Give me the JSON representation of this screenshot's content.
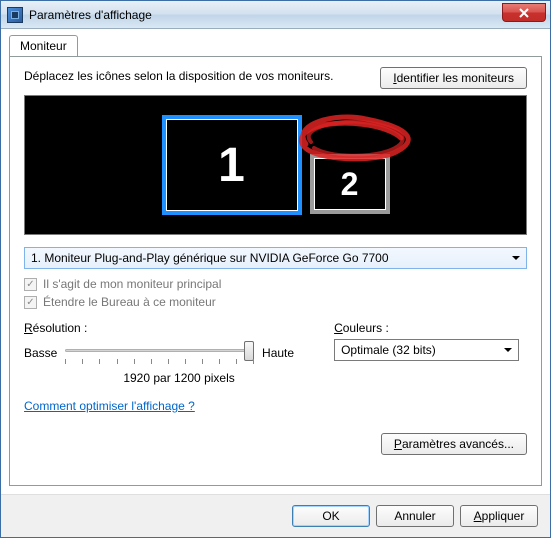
{
  "window": {
    "title": "Paramètres d'affichage"
  },
  "tab": {
    "label": "Moniteur"
  },
  "instructions": "Déplacez les icônes selon la disposition de vos moniteurs.",
  "identify_button": "Identifier les moniteurs",
  "monitors": {
    "primary_label": "1",
    "secondary_label": "2"
  },
  "monitor_dropdown": {
    "selected": "1. Moniteur Plug-and-Play générique sur NVIDIA GeForce Go 7700"
  },
  "checkboxes": {
    "primary": "Il s'agit de mon moniteur principal",
    "extend": "Étendre le Bureau à ce moniteur"
  },
  "resolution": {
    "label": "Résolution :",
    "low": "Basse",
    "high": "Haute",
    "value": "1920 par 1200 pixels"
  },
  "colors": {
    "label": "Couleurs :",
    "selected": "Optimale (32 bits)"
  },
  "link": "Comment optimiser l'affichage ?",
  "advanced_button": "Paramètres avancés...",
  "buttons": {
    "ok": "OK",
    "cancel": "Annuler",
    "apply": "Appliquer"
  }
}
